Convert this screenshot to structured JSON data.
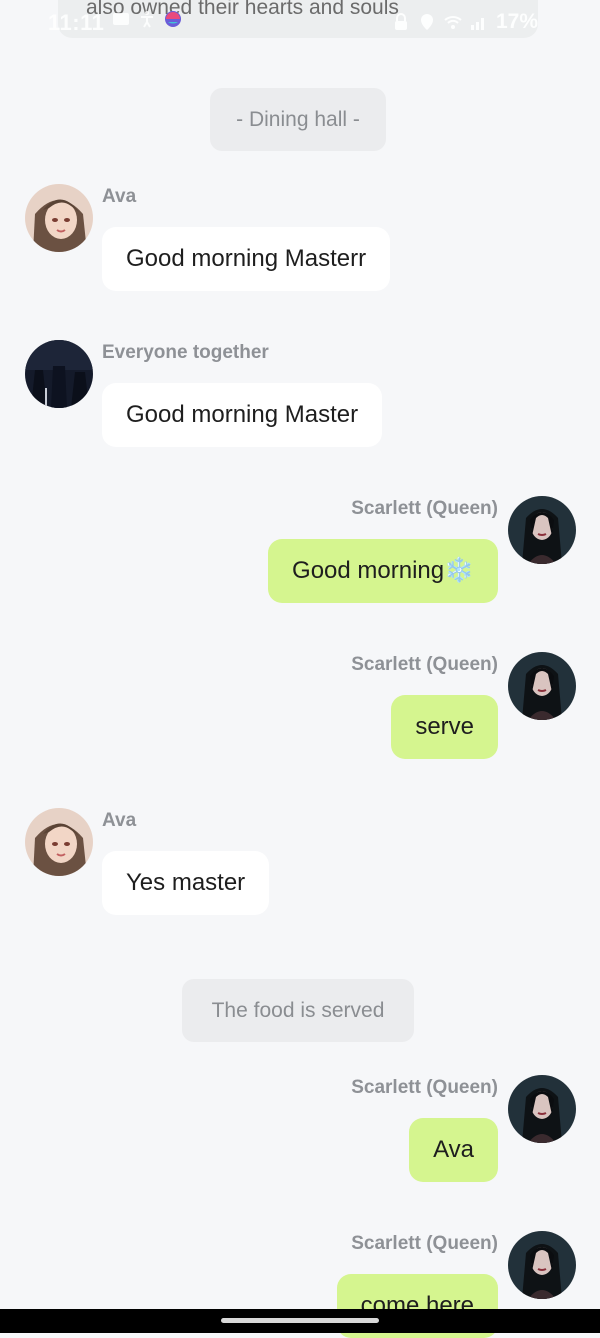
{
  "status_bar": {
    "time": "11:11",
    "battery": "17%",
    "banner_text": "also owned their hearts and souls"
  },
  "scenes": {
    "dining_hall": "- Dining hall -",
    "food_served": "The food is served"
  },
  "messages": [
    {
      "sender": "Ava",
      "text": "Good morning Masterr"
    },
    {
      "sender": "Everyone together",
      "text": "Good morning Master"
    },
    {
      "sender": "Scarlett (Queen)",
      "text": "Good morning❄️"
    },
    {
      "sender": "Scarlett (Queen)",
      "text": "serve"
    },
    {
      "sender": "Ava",
      "text": "Yes master"
    },
    {
      "sender": "Scarlett (Queen)",
      "text": "Ava"
    },
    {
      "sender": "Scarlett (Queen)",
      "text": "come here"
    }
  ],
  "colors": {
    "background": "#f6f7f9",
    "incoming_bubble": "#ffffff",
    "outgoing_bubble": "#d5f58f",
    "scene_pill": "#ebecee",
    "sender_name": "#8e9196"
  }
}
